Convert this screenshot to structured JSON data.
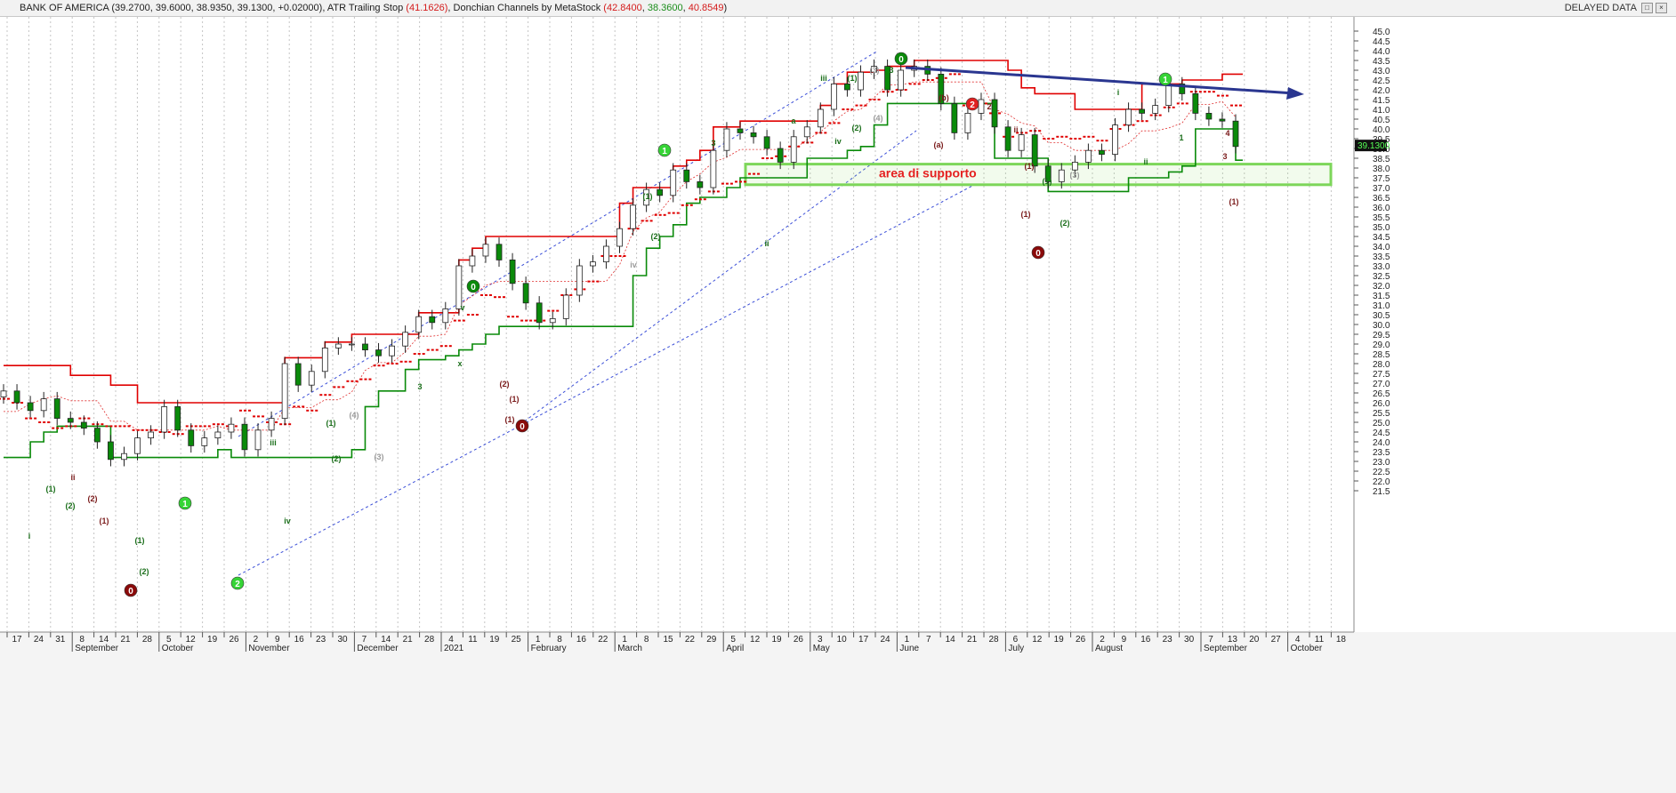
{
  "header": {
    "symbol": "BANK OF AMERICA",
    "ohlc": "(39.2700, 39.6000, 38.9350, 39.1300, +0.02000)",
    "atr_label": "ATR Trailing Stop",
    "atr_value": "(41.1626)",
    "donchian_label": "Donchian Channels by MetaStock",
    "donchian_values": [
      "(42.8400",
      "38.3600",
      "40.8549"
    ],
    "donchian_close": ")",
    "delayed": "DELAYED DATA"
  },
  "chart_data": {
    "type": "line",
    "title": "",
    "xlabel": "",
    "ylabel": "",
    "ylim": [
      21.0,
      45.4
    ],
    "y_ticks": [
      "45.0",
      "44.5",
      "44.0",
      "43.5",
      "43.0",
      "42.5",
      "42.0",
      "41.5",
      "41.0",
      "40.5",
      "40.0",
      "39.5",
      "39.0",
      "38.5",
      "38.0",
      "37.5",
      "37.0",
      "36.5",
      "36.0",
      "35.5",
      "35.0",
      "34.5",
      "34.0",
      "33.5",
      "33.0",
      "32.5",
      "32.0",
      "31.5",
      "31.0",
      "30.5",
      "30.0",
      "29.5",
      "29.0",
      "28.5",
      "28.0",
      "27.5",
      "27.0",
      "26.5",
      "26.0",
      "25.5",
      "25.0",
      "24.5",
      "24.0",
      "23.5",
      "23.0",
      "22.5",
      "22.0",
      "21.5"
    ],
    "last_price": "39.1300",
    "x_day_ticks": [
      "17",
      "24",
      "31",
      "8",
      "14",
      "21",
      "28",
      "5",
      "12",
      "19",
      "26",
      "2",
      "9",
      "16",
      "23",
      "30",
      "7",
      "14",
      "21",
      "28",
      "4",
      "11",
      "19",
      "25",
      "1",
      "8",
      "16",
      "22",
      "1",
      "8",
      "15",
      "22",
      "29",
      "5",
      "12",
      "19",
      "26",
      "3",
      "10",
      "17",
      "24",
      "1",
      "7",
      "14",
      "21",
      "28",
      "6",
      "12",
      "19",
      "26",
      "2",
      "9",
      "16",
      "23",
      "30",
      "7",
      "13",
      "20",
      "27",
      "4",
      "11",
      "18",
      "25"
    ],
    "x_month_ticks": [
      "September",
      "October",
      "November",
      "December",
      "2021",
      "February",
      "March",
      "April",
      "May",
      "June",
      "July",
      "August",
      "September",
      "October"
    ],
    "series": [
      {
        "values": [
          26.6,
          26.0,
          25.6,
          26.2,
          25.2,
          25.0,
          24.7,
          24.0,
          23.1,
          23.4,
          24.2,
          24.5,
          25.8,
          24.6,
          23.8,
          24.2,
          24.5,
          24.9,
          23.6,
          24.6,
          25.2,
          28.0,
          26.9,
          27.6,
          28.8,
          29.0,
          29.0,
          28.7,
          28.4,
          28.9,
          29.6,
          30.4,
          30.1,
          30.8,
          33.0,
          33.5,
          34.1,
          33.3,
          32.1,
          31.1,
          30.1,
          30.3,
          31.5,
          33.0,
          33.2,
          34.0,
          34.9,
          36.1,
          36.9,
          36.6,
          37.9,
          37.3,
          37.0,
          38.9,
          40.0,
          39.8,
          39.6,
          39.0,
          38.3,
          39.6,
          40.1,
          41.0,
          42.3,
          42.0,
          42.9,
          43.2,
          42.0,
          43.0,
          43.2,
          42.8,
          41.3,
          39.8,
          40.8,
          41.5,
          40.1,
          38.9,
          39.7,
          38.1,
          37.3,
          37.9,
          38.3,
          38.9,
          38.7,
          40.2,
          41.0,
          40.8,
          41.2,
          42.3,
          41.8,
          40.8,
          40.5,
          40.4,
          39.1
        ]
      },
      {
        "name": "ATR Trailing Stop",
        "values": [
          26.2,
          26.0,
          25.2,
          25.0,
          24.7,
          24.8,
          25.2,
          24.9,
          24.8,
          24.8,
          24.6,
          24.6,
          24.5,
          24.4,
          24.8,
          24.8,
          24.9,
          24.8,
          25.6,
          25.3,
          25.0,
          24.9,
          25.8,
          25.6,
          26.4,
          26.8,
          27.1,
          27.2,
          27.9,
          28.0,
          28.1,
          28.5,
          28.7,
          28.9,
          30.2,
          30.5,
          31.5,
          31.4,
          30.4,
          30.2,
          30.2,
          30.7,
          31.5,
          31.8,
          32.2,
          33.5,
          33.5,
          34.9,
          35.3,
          35.6,
          35.7,
          36.1,
          36.4,
          36.8,
          37.2,
          37.3,
          37.7,
          38.5,
          38.6,
          39.1,
          39.3,
          39.8,
          40.3,
          41.0,
          41.2,
          41.5,
          41.9,
          42.0,
          42.3,
          42.5,
          42.6,
          42.8,
          41.2,
          41.3,
          40.8,
          39.6,
          39.8,
          39.9,
          39.5,
          39.6,
          39.5,
          39.6,
          39.4,
          40.0,
          40.2,
          40.4,
          40.7,
          41.1,
          41.3,
          41.9,
          41.9,
          41.7,
          41.2
        ]
      },
      {
        "name": "Donchian Channels by MetaStock",
        "values": [
          27.9,
          27.9,
          27.9,
          27.9,
          27.9,
          27.4,
          27.4,
          27.4,
          26.9,
          26.9,
          26.0,
          26.0,
          26.0,
          26.0,
          26.0,
          26.0,
          26.0,
          26.0,
          26.0,
          26.0,
          26.0,
          28.3,
          28.3,
          28.3,
          29.1,
          29.1,
          29.5,
          29.5,
          29.5,
          29.5,
          29.5,
          30.6,
          30.6,
          30.6,
          33.3,
          33.9,
          34.5,
          34.5,
          34.5,
          34.5,
          34.5,
          34.5,
          34.5,
          34.5,
          34.5,
          34.5,
          36.2,
          37.0,
          37.0,
          37.0,
          38.1,
          38.4,
          38.9,
          40.1,
          40.1,
          40.4,
          40.4,
          40.4,
          40.4,
          40.4,
          40.4,
          41.2,
          42.3,
          42.9,
          42.9,
          43.0,
          43.2,
          43.2,
          43.5,
          43.5,
          43.5,
          43.5,
          43.5,
          43.5,
          43.5,
          43.0,
          42.1,
          41.8,
          41.8,
          41.8,
          41.0,
          41.0,
          41.0,
          41.0,
          41.0,
          42.3,
          42.3,
          42.3,
          42.5,
          42.5,
          42.5,
          42.8,
          42.8
        ]
      },
      {
        "name": "Donchian Channels by MetaStock",
        "values": [
          23.2,
          23.2,
          24.0,
          24.5,
          24.8,
          24.8,
          24.8,
          24.8,
          23.2,
          23.2,
          23.2,
          23.2,
          23.2,
          23.2,
          23.2,
          23.2,
          23.6,
          23.2,
          23.2,
          23.2,
          23.2,
          23.2,
          23.2,
          23.2,
          23.2,
          23.2,
          23.6,
          25.8,
          26.6,
          26.6,
          27.7,
          28.2,
          28.2,
          28.4,
          28.7,
          29.0,
          29.5,
          29.9,
          29.9,
          29.9,
          29.9,
          29.9,
          29.9,
          29.9,
          29.9,
          29.9,
          29.9,
          32.5,
          33.9,
          34.5,
          35.1,
          36.2,
          36.5,
          36.5,
          37.0,
          37.5,
          37.5,
          37.5,
          37.5,
          37.5,
          38.5,
          38.5,
          38.5,
          38.9,
          39.1,
          40.2,
          41.3,
          41.3,
          41.3,
          41.3,
          41.3,
          41.3,
          41.3,
          41.3,
          38.5,
          38.5,
          38.5,
          38.5,
          36.8,
          36.8,
          36.8,
          36.8,
          36.8,
          36.8,
          37.5,
          37.5,
          37.5,
          37.8,
          38.1,
          40.0,
          40.0,
          40.0,
          38.4
        ]
      }
    ],
    "annotations": {
      "support_area": "area di supporto",
      "wave_labels": [
        "(1)",
        "(2)",
        "i",
        "ii",
        "iii",
        "iv",
        "v",
        "x",
        "a",
        "(a)",
        "(b)",
        "1",
        "2",
        "3",
        "4",
        "(3)",
        "(4)"
      ],
      "circle_labels": [
        "0",
        "1",
        "2"
      ]
    },
    "colors": {
      "candle_up": "#ffffff",
      "candle_down": "#0a8a0a",
      "atr": "#e00000",
      "donchian_upper": "#e00000",
      "donchian_lower": "#098a09",
      "trend_line": "#2a3690",
      "support_box": "#7dd65a"
    }
  }
}
